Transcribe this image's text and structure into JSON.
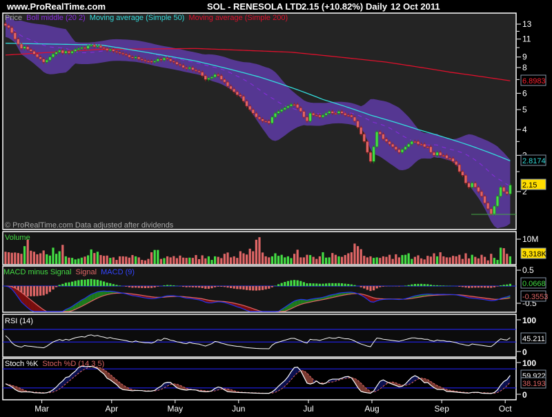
{
  "header": {
    "site": "www.ProRealTime.com",
    "title": "SOL - RENESOLA LTD.",
    "price_change": "2.15 (+10.82%)",
    "period": "Daily",
    "date": "12 Oct 2011"
  },
  "colors": {
    "up": "#44dd44",
    "down": "#e06666",
    "boll": "#5b3a9e",
    "ma50": "#33dddd",
    "ma200": "#e0102c",
    "macd": "#2233ee",
    "signal": "#e06666",
    "hist_up": "#44dd44",
    "rsi": "#ffffff",
    "level": "#2222ee"
  },
  "price_panel": {
    "legend": {
      "price": "Price",
      "boll": "Boll middle (20 2)",
      "ma50": "Moving average (Simple 50)",
      "ma200": "Moving average (Simple 200)"
    },
    "footer": "© ProRealTime.com  Data adjusted after dividends",
    "ticks": [
      "13",
      "11",
      "9",
      "8",
      "6",
      "5",
      "4",
      "3",
      "2"
    ],
    "labels": {
      "ma200": "6.8983",
      "ma50": "2.8174",
      "last": "2.15"
    }
  },
  "volume_panel": {
    "legend": "Volume",
    "tick": "10M",
    "last": "3,318K"
  },
  "macd_panel": {
    "legend_hist": "MACD minus Signal",
    "legend_signal": "Signal",
    "legend_macd": "MACD (9)",
    "ticks": [
      "0.5",
      "-0.5"
    ],
    "hist_last": "0.0668",
    "signal_last": "-0.3553"
  },
  "rsi_panel": {
    "legend": "RSI (14)",
    "ticks": [
      "100",
      "0"
    ],
    "last": "45.211",
    "levels": [
      70,
      30
    ]
  },
  "stoch_panel": {
    "legend_k": "Stoch %K",
    "legend_d": "Stoch %D (14 3 5)",
    "ticks": [
      "100",
      "0"
    ],
    "k_last": "59.922",
    "d_last": "38.193",
    "levels": [
      80,
      20
    ]
  },
  "chart_data": {
    "type": "candlestick",
    "price_scale": "log",
    "ylim": [
      1.4,
      14
    ],
    "x_months": [
      {
        "label": "Mar",
        "index": 6
      },
      {
        "label": "Apr",
        "index": 28
      },
      {
        "label": "May",
        "index": 48
      },
      {
        "label": "Jun",
        "index": 68
      },
      {
        "label": "Jul",
        "index": 90
      },
      {
        "label": "Aug",
        "index": 110
      },
      {
        "label": "Sep",
        "index": 132
      },
      {
        "label": "Oct",
        "index": 152
      }
    ],
    "close": [
      12.8,
      12.5,
      11.8,
      11.0,
      10.4,
      9.9,
      10.1,
      9.8,
      9.6,
      9.3,
      9.0,
      8.8,
      8.5,
      8.7,
      9.0,
      9.3,
      9.5,
      9.7,
      9.4,
      9.6,
      9.4,
      9.6,
      9.8,
      9.9,
      10.0,
      9.9,
      10.2,
      10.3,
      10.1,
      10.2,
      10.0,
      9.9,
      9.7,
      9.8,
      9.6,
      9.5,
      9.4,
      9.3,
      9.2,
      9.0,
      8.9,
      9.0,
      8.8,
      8.7,
      8.6,
      8.6,
      8.5,
      8.6,
      8.8,
      8.7,
      8.9,
      8.8,
      8.6,
      8.5,
      8.3,
      8.2,
      8.0,
      7.9,
      8.0,
      7.8,
      7.7,
      7.6,
      7.3,
      7.0,
      7.1,
      7.2,
      7.4,
      7.3,
      7.0,
      6.8,
      6.5,
      6.3,
      6.1,
      5.9,
      5.8,
      5.5,
      5.2,
      5.0,
      4.8,
      4.6,
      4.5,
      4.4,
      4.4,
      4.3,
      4.6,
      4.8,
      4.9,
      5.0,
      5.1,
      5.2,
      5.3,
      5.3,
      5.1,
      4.9,
      4.6,
      4.4,
      4.8,
      4.7,
      4.7,
      4.6,
      4.7,
      4.8,
      4.9,
      4.8,
      4.8,
      4.9,
      4.8,
      4.7,
      4.7,
      4.6,
      4.4,
      4.1,
      3.8,
      3.5,
      3.1,
      2.8,
      3.3,
      3.9,
      3.8,
      3.6,
      3.5,
      3.4,
      3.3,
      3.2,
      3.1,
      3.2,
      3.3,
      3.4,
      3.5,
      3.5,
      3.4,
      3.4,
      3.3,
      3.3,
      3.1,
      3.0,
      3.1,
      3.0,
      3.0,
      2.9,
      2.9,
      2.8,
      2.7,
      2.5,
      2.4,
      2.2,
      2.1,
      2.2,
      2.1,
      2.0,
      1.9,
      1.76,
      1.65,
      1.56,
      1.7,
      1.9,
      2.1,
      2.0,
      1.95,
      2.15
    ],
    "volume_millions": [
      4.8,
      4.6,
      4.4,
      4.5,
      4.3,
      4.0,
      7.0,
      9.5,
      5.2,
      4.8,
      3.8,
      4.2,
      5.3,
      3.8,
      3.3,
      6.4,
      4.0,
      5.0,
      7.5,
      3.0,
      2.5,
      2.4,
      1.8,
      2.1,
      2.5,
      2.9,
      3.4,
      5.7,
      4.3,
      4.8,
      3.5,
      3.2,
      3.3,
      2.4,
      2.6,
      1.6,
      3.0,
      3.0,
      2.9,
      2.5,
      3.5,
      3.0,
      2.6,
      1.6,
      1.4,
      2.0,
      4.6,
      5.5,
      5.5,
      2.0,
      2.3,
      3.0,
      2.6,
      3.1,
      2.3,
      3.3,
      2.5,
      2.4,
      2.5,
      2.4,
      3.5,
      1.9,
      3.4,
      2.2,
      3.0,
      1.6,
      3.0,
      2.8,
      2.3,
      4.0,
      4.5,
      2.6,
      3.0,
      2.4,
      5.0,
      4.2,
      3.7,
      6.0,
      5.0,
      9.5,
      10.5,
      4.5,
      3.0,
      2.6,
      3.0,
      4.2,
      3.2,
      3.6,
      2.6,
      3.0,
      2.3,
      4.0,
      5.6,
      2.6,
      2.6,
      3.6,
      3.5,
      2.8,
      2.0,
      3.0,
      4.6,
      2.5,
      2.6,
      4.3,
      3.6,
      3.0,
      2.8,
      3.5,
      4.2,
      4.6,
      8.0,
      7.0,
      5.8,
      3.2,
      2.6,
      3.0,
      2.4,
      2.6,
      2.4,
      3.0,
      2.8,
      3.6,
      2.0,
      3.8,
      2.6,
      3.5,
      3.6,
      4.2,
      2.0,
      2.8,
      3.4,
      2.2,
      1.8,
      3.2,
      2.9,
      4.2,
      3.0,
      4.6,
      3.0,
      2.6,
      2.6,
      3.2,
      3.0,
      3.6,
      2.0,
      4.2,
      2.2,
      3.6,
      2.8,
      2.2,
      3.6,
      2.8,
      1.4,
      4.0,
      2.4,
      1.6,
      6.4,
      6.2,
      4.0,
      3.0,
      4.0,
      1.5,
      2.0,
      3.3
    ],
    "ma50": [
      {
        "index": 0,
        "value": 10.5
      },
      {
        "index": 30,
        "value": 10.3
      },
      {
        "index": 60,
        "value": 8.6
      },
      {
        "index": 80,
        "value": 7.2
      },
      {
        "index": 100,
        "value": 5.6
      },
      {
        "index": 115,
        "value": 4.7
      },
      {
        "index": 130,
        "value": 4.0
      },
      {
        "index": 145,
        "value": 3.4
      },
      {
        "index": 159,
        "value": 2.82
      }
    ],
    "ma200": [
      {
        "index": 0,
        "value": 9.2
      },
      {
        "index": 30,
        "value": 9.8
      },
      {
        "index": 60,
        "value": 9.9
      },
      {
        "index": 90,
        "value": 9.5
      },
      {
        "index": 120,
        "value": 8.5
      },
      {
        "index": 140,
        "value": 7.6
      },
      {
        "index": 159,
        "value": 6.9
      }
    ]
  }
}
